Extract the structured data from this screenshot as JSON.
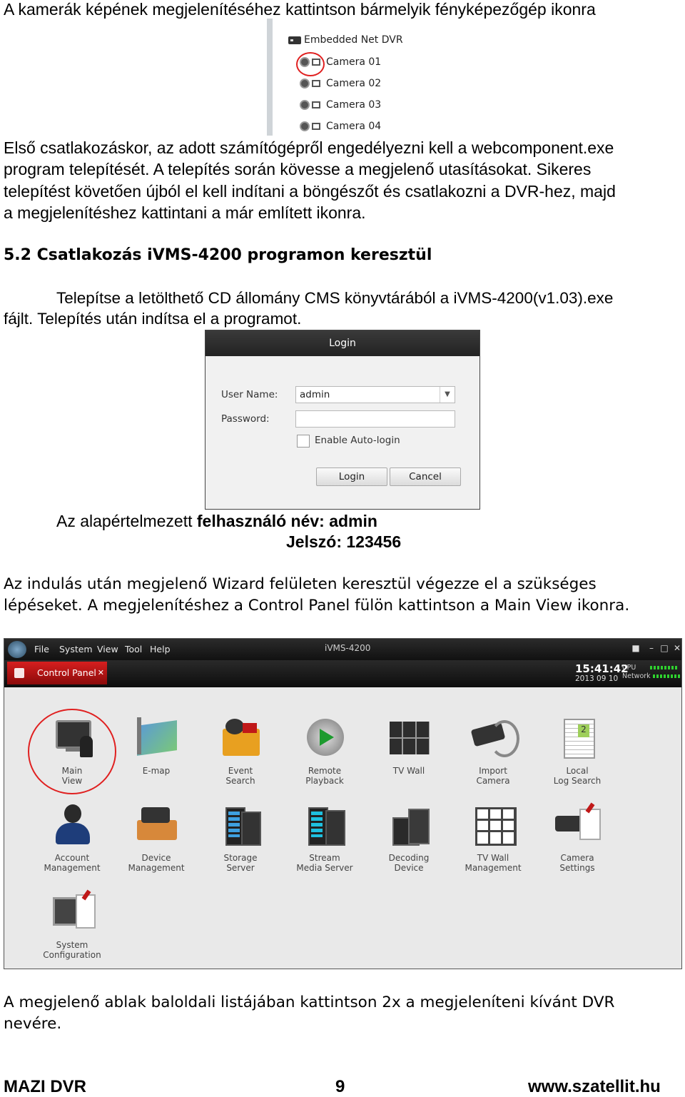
{
  "intro_line": "A kamerák képének megjelenítéséhez kattintson bármelyik fényképezőgép ikonra",
  "dvr_tree": {
    "root_label": "Embedded Net DVR",
    "cameras": [
      "Camera 01",
      "Camera 02",
      "Camera 03",
      "Camera 04"
    ]
  },
  "para1": [
    "Első csatlakozáskor, az adott számítógépről engedélyezni kell a webcomponent.exe",
    "program telepítését. A telepítés során kövesse a megjelenő utasításokat. Sikeres",
    "telepítést követően újból el kell indítani a böngészőt és csatlakozni a DVR-hez, majd",
    "a megjelenítéshez kattintani a már említett ikonra."
  ],
  "section_heading": "5.2 Csatlakozás iVMS-4200 programon keresztül",
  "install_line1": "Telepítse a letölthető CD állomány CMS könyvtárából a iVMS-4200(v1.03).exe",
  "install_line2": "fájlt. Telepítés után indítsa el a programot.",
  "login": {
    "title": "Login",
    "user_label": "User Name:",
    "user_value": "admin",
    "password_label": "Password:",
    "password_value": "",
    "auto_login_label": "Enable Auto-login",
    "login_button": "Login",
    "cancel_button": "Cancel"
  },
  "defaults": {
    "lead": "Az alapértelmezett ",
    "user_bold": "felhasználó név: admin",
    "password_bold": "Jelszó: 123456"
  },
  "para2": [
    "Az indulás után megjelenő Wizard felületen keresztül végezze el a szükséges",
    "lépéseket. A megjelenítéshez a Control Panel fülön kattintson a Main View ikonra."
  ],
  "ivms": {
    "menu": [
      "File",
      "System",
      "View",
      "Tool",
      "Help"
    ],
    "app_title": "iVMS-4200",
    "tab_label": "Control Panel",
    "clock_time": "15:41:42",
    "clock_date": "2013 09 10",
    "cpu_label": "CPU",
    "network_label": "Network",
    "tiles": [
      {
        "label": "Main\nView",
        "icon": "monitor-user-icon"
      },
      {
        "label": "E-map",
        "icon": "map-icon"
      },
      {
        "label": "Event\nSearch",
        "icon": "event-folder-icon"
      },
      {
        "label": "Remote\nPlayback",
        "icon": "playback-icon"
      },
      {
        "label": "TV Wall",
        "icon": "tv-wall-icon"
      },
      {
        "label": "Import\nCamera",
        "icon": "camera-import-icon"
      },
      {
        "label": "Local\nLog Search",
        "icon": "log-icon"
      },
      {
        "label": "Account\nManagement",
        "icon": "user-icon"
      },
      {
        "label": "Device\nManagement",
        "icon": "device-icon"
      },
      {
        "label": "Storage\nServer",
        "icon": "storage-icon"
      },
      {
        "label": "Stream\nMedia Server",
        "icon": "stream-server-icon"
      },
      {
        "label": "Decoding\nDevice",
        "icon": "decoder-icon"
      },
      {
        "label": "TV Wall\nManagement",
        "icon": "tv-wall-grid-icon"
      },
      {
        "label": "Camera\nSettings",
        "icon": "camera-settings-icon"
      },
      {
        "label": "System\nConfiguration",
        "icon": "system-config-icon"
      }
    ]
  },
  "para3": [
    "A megjelenő ablak baloldali listájában kattintson 2x a megjeleníteni kívánt DVR",
    "nevére."
  ],
  "footer": {
    "left": "MAZI DVR",
    "page": "9",
    "right": "www.szatellit.hu"
  },
  "colors": {
    "highlight": "#e02020",
    "tab_red": "#c41616"
  }
}
